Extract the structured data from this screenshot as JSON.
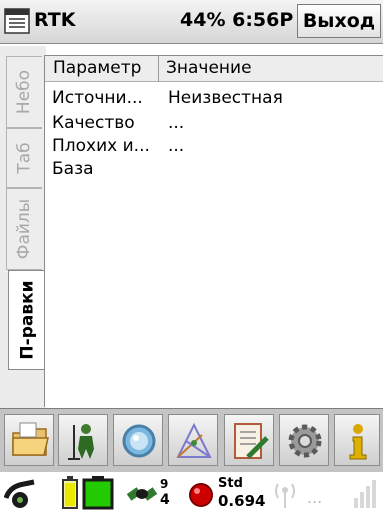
{
  "titlebar": {
    "app_title": "RTK",
    "status": "44% 6:56P",
    "exit_label": "Выход"
  },
  "tabs": [
    {
      "label": "Небо",
      "active": false
    },
    {
      "label": "Таб",
      "active": false
    },
    {
      "label": "Файлы",
      "active": false
    },
    {
      "label": "П-равки",
      "active": true
    }
  ],
  "table": {
    "columns": [
      "Параметр",
      "Значение"
    ],
    "rows": [
      {
        "param": "Источни...",
        "value": "Неизвестная"
      },
      {
        "param": "Качество",
        "value": "..."
      },
      {
        "param": "Плохих и...",
        "value": "..."
      },
      {
        "param": "База",
        "value": ""
      }
    ]
  },
  "toolbar": {
    "buttons": [
      "folder-icon",
      "surveyor-icon",
      "magnifier-icon",
      "network-triangle-icon",
      "notebook-pen-icon",
      "gear-icon",
      "info-icon"
    ]
  },
  "statusbar": {
    "sat_top": "9",
    "sat_bottom": "4",
    "std_label": "Std",
    "std_value": "0.694",
    "ellipsis": "...",
    "battery_color": "#22cc00",
    "led_color": "#cc0000"
  }
}
